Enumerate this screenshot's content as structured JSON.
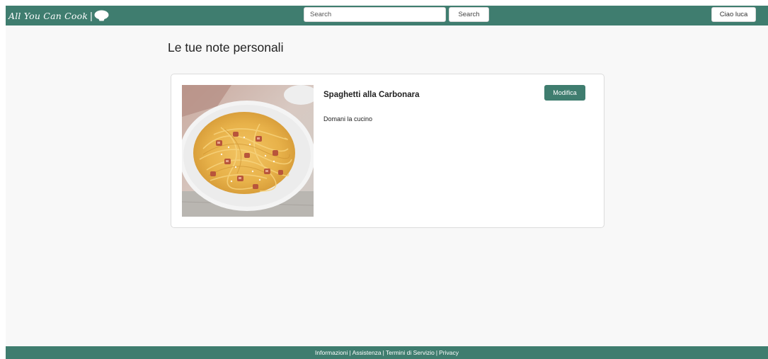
{
  "header": {
    "brand_name": "All You Can Cook",
    "brand_separator": "|",
    "brand_icon": "chef-hat-icon",
    "search_placeholder": "Search",
    "search_button_label": "Search",
    "user_greeting": "Ciao luca"
  },
  "main": {
    "page_title": "Le tue note personali",
    "notes": [
      {
        "title": "Spaghetti alla Carbonara",
        "text": "Domani la cucino",
        "edit_label": "Modifica",
        "image": "spaghetti-carbonara-photo"
      }
    ]
  },
  "footer": {
    "links": [
      "Informazioni",
      "Assistenza",
      "Termini di Servizio",
      "Privacy"
    ],
    "separator": "|"
  },
  "colors": {
    "brand_green": "#3f7d6f",
    "page_background": "#f8f8f8",
    "card_background": "#ffffff"
  }
}
